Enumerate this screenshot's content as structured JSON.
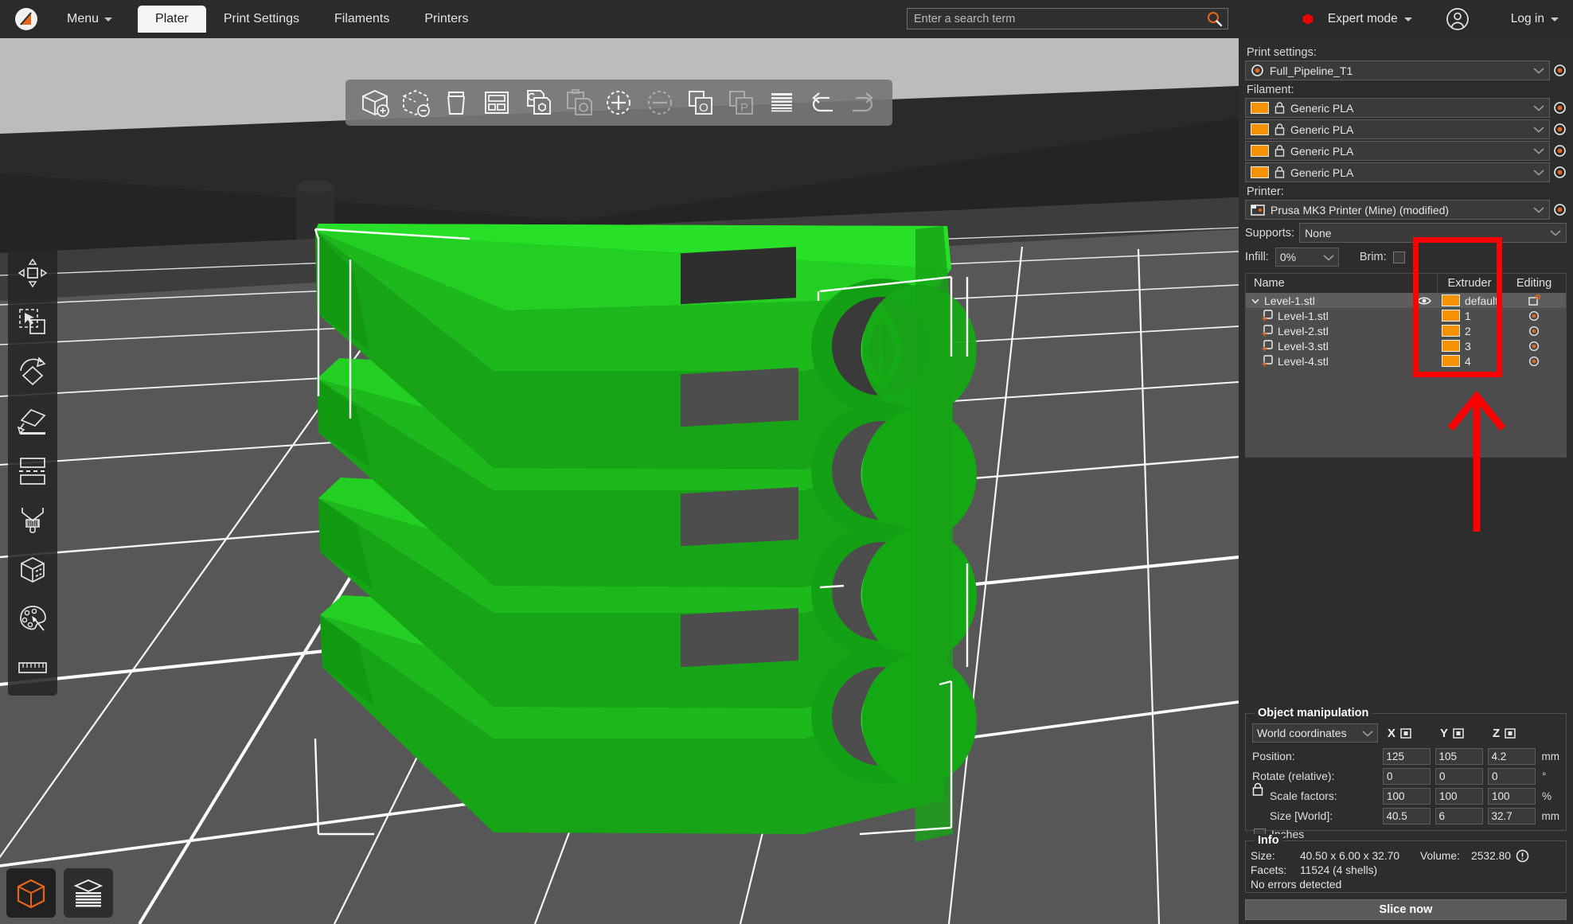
{
  "app": {
    "logo_icon": "prusa-logo-icon",
    "menu_label": "Menu",
    "tabs": [
      {
        "label": "Plater",
        "active": true
      },
      {
        "label": "Print Settings",
        "active": false
      },
      {
        "label": "Filaments",
        "active": false
      },
      {
        "label": "Printers",
        "active": false
      }
    ],
    "search": {
      "placeholder": "Enter a search term",
      "value": "",
      "icon": "search-icon"
    },
    "mode": {
      "label": "Expert mode",
      "dot_color": "#ee0000",
      "icon": "mode-dot-icon"
    },
    "account_icon": "user-avatar-icon",
    "login_label": "Log in"
  },
  "toolbar": {
    "items": [
      {
        "name": "add-object",
        "icon": "cube-plus-icon",
        "disabled": false
      },
      {
        "name": "delete-object",
        "icon": "cube-dashed-minus-icon",
        "disabled": false
      },
      {
        "name": "delete-all",
        "icon": "trash-icon",
        "disabled": false
      },
      {
        "name": "arrange",
        "icon": "arrange-grid-icon",
        "disabled": false
      },
      {
        "name": "copy",
        "icon": "copy-icon",
        "disabled": false
      },
      {
        "name": "paste",
        "icon": "paste-icon",
        "disabled": true
      },
      {
        "name": "add-instance",
        "icon": "circle-plus-icon",
        "disabled": false
      },
      {
        "name": "remove-instance",
        "icon": "circle-minus-icon",
        "disabled": true
      },
      {
        "name": "split-to-objects",
        "icon": "split-objects-icon",
        "disabled": false
      },
      {
        "name": "split-to-parts",
        "icon": "split-parts-icon",
        "disabled": true
      },
      {
        "name": "variable-layer-height",
        "icon": "layers-icon",
        "disabled": false
      },
      {
        "name": "undo",
        "icon": "undo-arrow-icon",
        "disabled": false
      },
      {
        "name": "redo",
        "icon": "redo-arrow-icon",
        "disabled": true
      }
    ]
  },
  "gizmos": {
    "items": [
      {
        "name": "move-gizmo",
        "icon": "move-arrows-icon"
      },
      {
        "name": "scale-gizmo",
        "icon": "scale-cursor-icon"
      },
      {
        "name": "rotate-gizmo",
        "icon": "rotate-diamond-icon"
      },
      {
        "name": "place-on-face-gizmo",
        "icon": "place-on-face-icon"
      },
      {
        "name": "cut-gizmo",
        "icon": "cut-plane-icon"
      },
      {
        "name": "support-paint-gizmo",
        "icon": "support-brush-icon"
      },
      {
        "name": "seam-paint-gizmo",
        "icon": "seam-cube-icon"
      },
      {
        "name": "mmu-paint-gizmo",
        "icon": "palette-icon"
      },
      {
        "name": "measure-gizmo",
        "icon": "ruler-icon"
      }
    ]
  },
  "view_modes": {
    "items": [
      {
        "name": "editor-view",
        "icon": "cube-outline-icon",
        "selected": true
      },
      {
        "name": "preview-view",
        "icon": "layer-stack-icon",
        "selected": false
      }
    ]
  },
  "settings": {
    "print_settings_label": "Print settings:",
    "print_settings_value": "Full_Pipeline_T1",
    "filament_label": "Filament:",
    "filaments": [
      {
        "value": "Generic PLA",
        "color": "#f59200"
      },
      {
        "value": "Generic PLA",
        "color": "#f59200"
      },
      {
        "value": "Generic PLA",
        "color": "#f59200"
      },
      {
        "value": "Generic PLA",
        "color": "#f59200"
      }
    ],
    "printer_label": "Printer:",
    "printer_value": "Prusa MK3 Printer (Mine) (modified)",
    "supports_label": "Supports:",
    "supports_value": "None",
    "infill_label": "Infill:",
    "infill_value": "0%",
    "brim_label": "Brim:",
    "brim_checked": false
  },
  "object_tree": {
    "columns": [
      "Name",
      "Extruder",
      "Editing"
    ],
    "rows": [
      {
        "name": "Level-1.stl",
        "extruder": "default",
        "extruder_color": "#f59200",
        "level": 0,
        "selected": true,
        "expanded": true,
        "eye_icon": "eye-icon",
        "edit_icon": "object-settings-icon"
      },
      {
        "name": "Level-1.stl",
        "extruder": "1",
        "extruder_color": "#f59200",
        "level": 1,
        "selected": false,
        "part_icon": "part-add-icon",
        "edit_icon": "gear-icon"
      },
      {
        "name": "Level-2.stl",
        "extruder": "2",
        "extruder_color": "#f59200",
        "level": 1,
        "selected": false,
        "part_icon": "part-add-icon",
        "edit_icon": "gear-icon"
      },
      {
        "name": "Level-3.stl",
        "extruder": "3",
        "extruder_color": "#f59200",
        "level": 1,
        "selected": false,
        "part_icon": "part-add-icon",
        "edit_icon": "gear-icon"
      },
      {
        "name": "Level-4.stl",
        "extruder": "4",
        "extruder_color": "#f59200",
        "level": 1,
        "selected": false,
        "part_icon": "part-add-icon",
        "edit_icon": "gear-icon"
      }
    ]
  },
  "annotation": {
    "highlight_color": "#fe0000",
    "box_target": "extruder-column",
    "arrow_icon": "red-up-arrow-icon"
  },
  "object_manipulation": {
    "title": "Object manipulation",
    "coord_system": "World coordinates",
    "axis_labels": [
      "X",
      "Y",
      "Z"
    ],
    "rows": [
      {
        "label": "Position:",
        "x": "125",
        "y": "105",
        "z": "4.2",
        "unit": "mm",
        "indent": false
      },
      {
        "label": "Rotate (relative):",
        "x": "0",
        "y": "0",
        "z": "0",
        "unit": "°",
        "indent": false
      },
      {
        "label": "Scale factors:",
        "x": "100",
        "y": "100",
        "z": "100",
        "unit": "%",
        "indent": true
      },
      {
        "label": "Size [World]:",
        "x": "40.5",
        "y": "6",
        "z": "32.7",
        "unit": "mm",
        "indent": true
      }
    ],
    "inches_label": "Inches",
    "inches_checked": false,
    "lock_icon": "uniform-scale-lock-icon"
  },
  "info": {
    "title": "Info",
    "size_label": "Size:",
    "size_value": "40.50 x 6.00 x 32.70",
    "volume_label": "Volume:",
    "volume_value": "2532.80",
    "warn_icon": "info-exclamation-icon",
    "facets_label": "Facets:",
    "facets_value": "11524 (4 shells)",
    "errors_text": "No errors detected"
  },
  "slice_button": {
    "label": "Slice now"
  },
  "scene": {
    "model_color": "#1fbf1f",
    "bed_color": "#3a3a3a",
    "background_color": "#b9b9b9",
    "grid_color": "#ffffff"
  }
}
